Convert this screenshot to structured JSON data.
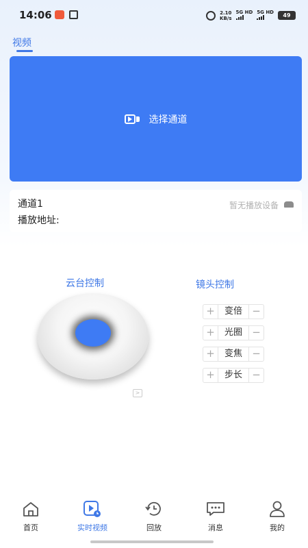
{
  "status_bar": {
    "time": "14:06",
    "net_speed_value": "2.10",
    "net_speed_unit": "KB/s",
    "signal1": "5G HD",
    "signal2": "5G HD",
    "battery": "49"
  },
  "tab": {
    "label": "视频"
  },
  "video": {
    "select_label": "选择通道"
  },
  "info": {
    "channel_name": "通道1",
    "play_address_label": "播放地址:",
    "no_device": "暂无播放设备"
  },
  "ptz": {
    "title": "云台控制"
  },
  "lens": {
    "title": "镜头控制",
    "controls": [
      {
        "label": "变倍",
        "plus": "+",
        "minus": "−"
      },
      {
        "label": "光圈",
        "plus": "+",
        "minus": "−"
      },
      {
        "label": "变焦",
        "plus": "+",
        "minus": "−"
      },
      {
        "label": "步长",
        "plus": "+",
        "minus": "−"
      }
    ]
  },
  "nav": {
    "items": [
      {
        "label": "首页",
        "icon": "home-icon"
      },
      {
        "label": "实时视频",
        "icon": "live-video-icon",
        "active": true
      },
      {
        "label": "回放",
        "icon": "playback-icon"
      },
      {
        "label": "消息",
        "icon": "message-icon"
      },
      {
        "label": "我的",
        "icon": "profile-icon"
      }
    ]
  },
  "colors": {
    "accent": "#3f78e6",
    "video_bg": "#3e7bf4"
  }
}
